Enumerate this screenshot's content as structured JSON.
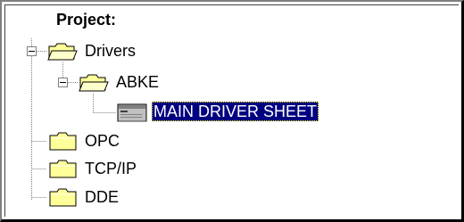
{
  "tree": {
    "header": "Project:",
    "nodes": [
      {
        "label": "Drivers",
        "icon": "folder-open-icon",
        "expanded": true
      },
      {
        "label": "ABKE",
        "icon": "folder-open-icon",
        "expanded": true
      },
      {
        "label": "MAIN DRIVER SHEET",
        "icon": "driver-sheet-icon",
        "selected": true
      },
      {
        "label": "OPC",
        "icon": "folder-closed-icon"
      },
      {
        "label": "TCP/IP",
        "icon": "folder-closed-icon"
      },
      {
        "label": "DDE",
        "icon": "folder-closed-icon"
      }
    ]
  },
  "colors": {
    "selection_bg": "#000080",
    "selection_text": "#ffffff",
    "folder": "#ffffa0"
  }
}
